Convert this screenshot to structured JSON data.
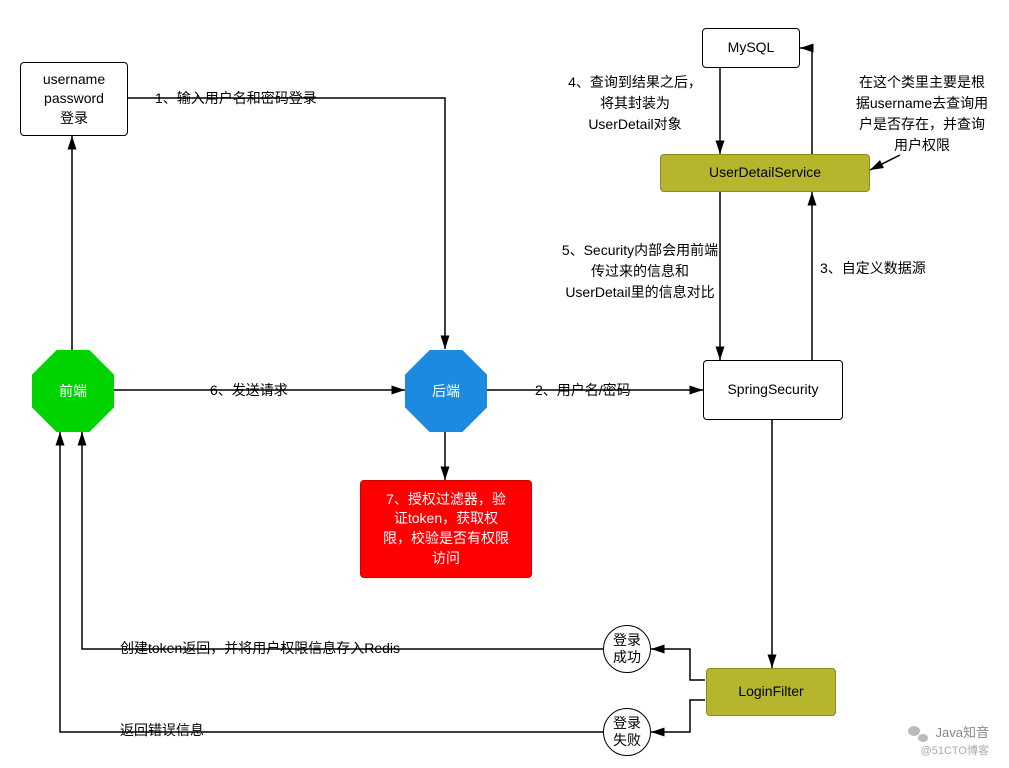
{
  "nodes": {
    "login_box": "username\npassword\n登录",
    "frontend": "前端",
    "backend": "后端",
    "mysql": "MySQL",
    "user_detail_service": "UserDetailService",
    "spring_security": "SpringSecurity",
    "login_filter": "LoginFilter",
    "auth_filter": "7、授权过滤器，验\n证token，获取权\n限，校验是否有权限\n访问",
    "login_success": "登录\n成功",
    "login_fail": "登录\n失败"
  },
  "edges": {
    "e1": "1、输入用户名和密码登录",
    "e2": "2、用户名/密码",
    "e3": "3、自定义数据源",
    "e4": "4、查询到结果之后，\n将其封装为\nUserDetail对象",
    "e5": "5、Security内部会用前端\n传过来的信息和\nUserDetail里的信息对比",
    "e6": "6、发送请求",
    "note_uds": "在这个类里主要是根\n据username去查询用\n户是否存在，并查询\n用户权限",
    "token_redis": "创建token返回，并将用户权限信息存入Redis",
    "return_error": "返回错误信息"
  },
  "watermark": {
    "line1": "Java知音",
    "line2": "@51CTO博客"
  }
}
